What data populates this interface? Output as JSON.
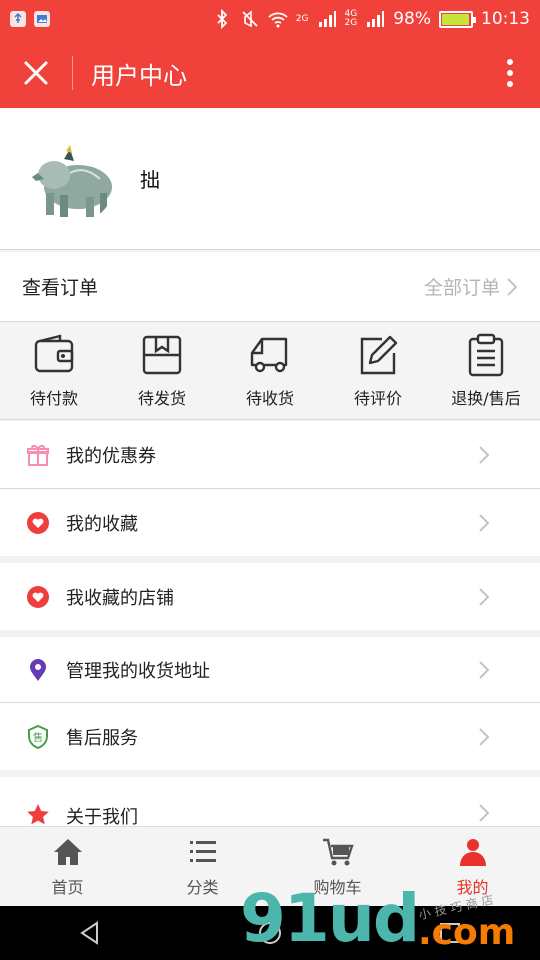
{
  "status_bar": {
    "network": "4G",
    "network2": "2G",
    "signal_label": "2G",
    "battery": "98%",
    "battery_level": 0.98,
    "time": "10:13"
  },
  "header": {
    "title": "用户中心"
  },
  "profile": {
    "username": "拙"
  },
  "orders": {
    "title": "查看订单",
    "all_label": "全部订单",
    "statuses": [
      {
        "label": "待付款",
        "icon": "wallet-icon"
      },
      {
        "label": "待发货",
        "icon": "box-icon"
      },
      {
        "label": "待收货",
        "icon": "truck-icon"
      },
      {
        "label": "待评价",
        "icon": "edit-icon"
      },
      {
        "label": "退换/售后",
        "icon": "clipboard-icon"
      }
    ]
  },
  "menu": [
    {
      "label": "我的优惠券",
      "icon": "gift-icon"
    },
    {
      "label": "我的收藏",
      "icon": "heart-icon"
    },
    {
      "label": "我收藏的店铺",
      "icon": "heart-icon"
    },
    {
      "label": "管理我的收货地址",
      "icon": "location-pin-icon"
    },
    {
      "label": "售后服务",
      "icon": "shield-icon",
      "icon_text": "售"
    },
    {
      "label": "关于我们",
      "icon": "star-icon"
    }
  ],
  "tabbar": {
    "items": [
      {
        "label": "首页",
        "icon": "home-icon"
      },
      {
        "label": "分类",
        "icon": "list-icon"
      },
      {
        "label": "购物车",
        "icon": "cart-icon"
      },
      {
        "label": "我的",
        "icon": "user-icon"
      }
    ],
    "active_index": 3
  },
  "watermark": {
    "big": "91ud",
    "com": ".com",
    "small": "小技巧商店"
  },
  "colors": {
    "brand": "#f0423b",
    "active_tab": "#e8322b",
    "gift": "#f48fb1",
    "heart": "#ef3e3e",
    "pin": "#673ab7",
    "shield": "#43a047",
    "star": "#ef3e3e"
  }
}
